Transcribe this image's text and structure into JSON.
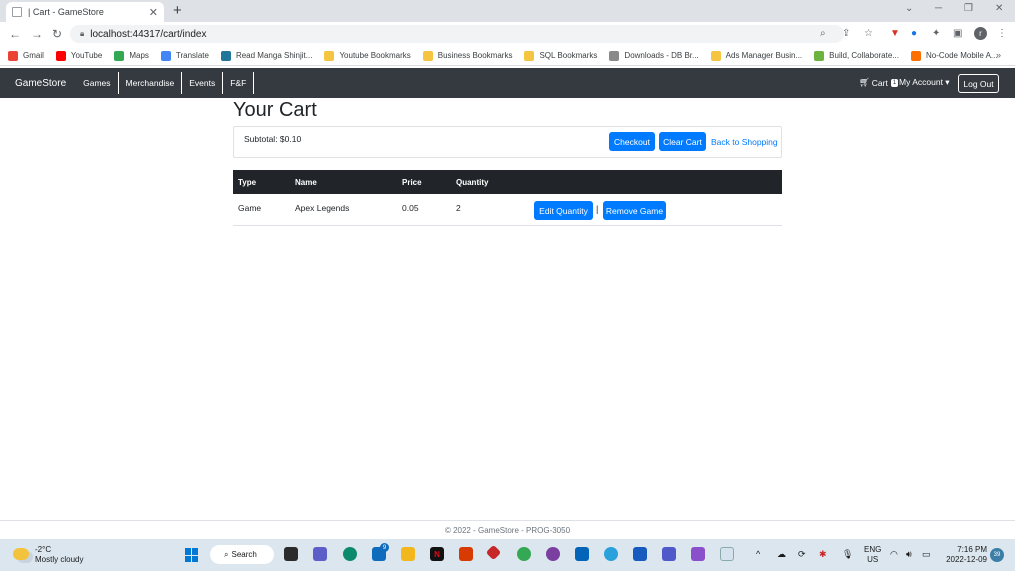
{
  "browser": {
    "tab_title": "| Cart - GameStore",
    "tab_close": "✕",
    "new_tab": "+",
    "url": "localhost:44317/cart/index",
    "profile_initial": "r",
    "bookmarks": [
      {
        "label": "Gmail",
        "color": "#ea4335"
      },
      {
        "label": "YouTube",
        "color": "#ff0000"
      },
      {
        "label": "Maps",
        "color": "#34a853"
      },
      {
        "label": "Translate",
        "color": "#4285f4"
      },
      {
        "label": "Read Manga Shinjit...",
        "color": "#21759b"
      },
      {
        "label": "Youtube Bookmarks",
        "color": "#f5c542"
      },
      {
        "label": "Business Bookmarks",
        "color": "#f5c542"
      },
      {
        "label": "SQL Bookmarks",
        "color": "#f5c542"
      },
      {
        "label": "Downloads - DB Br...",
        "color": "#8a8a8a"
      },
      {
        "label": "Ads Manager Busin...",
        "color": "#f5c542"
      },
      {
        "label": "Build, Collaborate...",
        "color": "#6db33f"
      },
      {
        "label": "No-Code Mobile A...",
        "color": "#ff6f00"
      }
    ],
    "bookmarks_more": "»"
  },
  "site_nav": {
    "brand": "GameStore",
    "links": [
      "Games",
      "Merchandise",
      "Events",
      "F&F"
    ],
    "cart_label": "Cart",
    "cart_count": "1",
    "account_label": "My Account ▾",
    "logout_label": "Log Out"
  },
  "cart": {
    "title": "Your Cart",
    "subtotal": "Subtotal: $0.10",
    "checkout_label": "Checkout",
    "clear_label": "Clear Cart",
    "back_label": "Back to Shopping",
    "columns": [
      "Type",
      "Name",
      "Price",
      "Quantity"
    ],
    "rows": [
      {
        "type": "Game",
        "name": "Apex Legends",
        "price": "0.05",
        "quantity": "2",
        "edit_label": "Edit Quantity",
        "separator": "|",
        "remove_label": "Remove Game"
      }
    ]
  },
  "footer": {
    "text": "© 2022 - GameStore - PROG-3050"
  },
  "taskbar": {
    "weather_temp": "-2°C",
    "weather_desc": "Mostly cloudy",
    "search_label": "Search",
    "mail_badge": "9",
    "lang_top": "ENG",
    "lang_bottom": "US",
    "time": "7:16 PM",
    "date": "2022-12-09",
    "notification_count": "39"
  }
}
